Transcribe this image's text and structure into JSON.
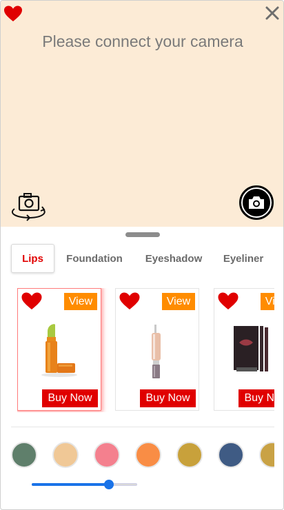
{
  "camera": {
    "message": "Please connect your camera",
    "background": "#fcebd6"
  },
  "icons": {
    "favorite": "heart-icon",
    "close": "close-icon",
    "flip_camera": "camera-flip-icon",
    "capture": "camera-icon"
  },
  "tabs": [
    {
      "label": "Lips",
      "active": true
    },
    {
      "label": "Foundation",
      "active": false
    },
    {
      "label": "Eyeshadow",
      "active": false
    },
    {
      "label": "Eyeliner",
      "active": false
    }
  ],
  "products": [
    {
      "view_label": "View",
      "buy_label": "Buy Now",
      "selected": true,
      "image": "lipstick-icon"
    },
    {
      "view_label": "View",
      "buy_label": "Buy Now",
      "selected": false,
      "image": "lip-gloss-icon"
    },
    {
      "view_label": "View",
      "buy_label": "Buy Now",
      "selected": false,
      "image": "lip-kit-icon"
    }
  ],
  "swatches": [
    "#5f7f6b",
    "#f0c896",
    "#f4808e",
    "#f98d45",
    "#c8a13b",
    "#3f5b84",
    "#c9a245"
  ],
  "intensity": {
    "value": 0.73
  },
  "colors": {
    "accent_red": "#e00000",
    "view_orange": "#ff8c00",
    "slider_blue": "#1a73e8",
    "tab_active": "#e10000"
  }
}
